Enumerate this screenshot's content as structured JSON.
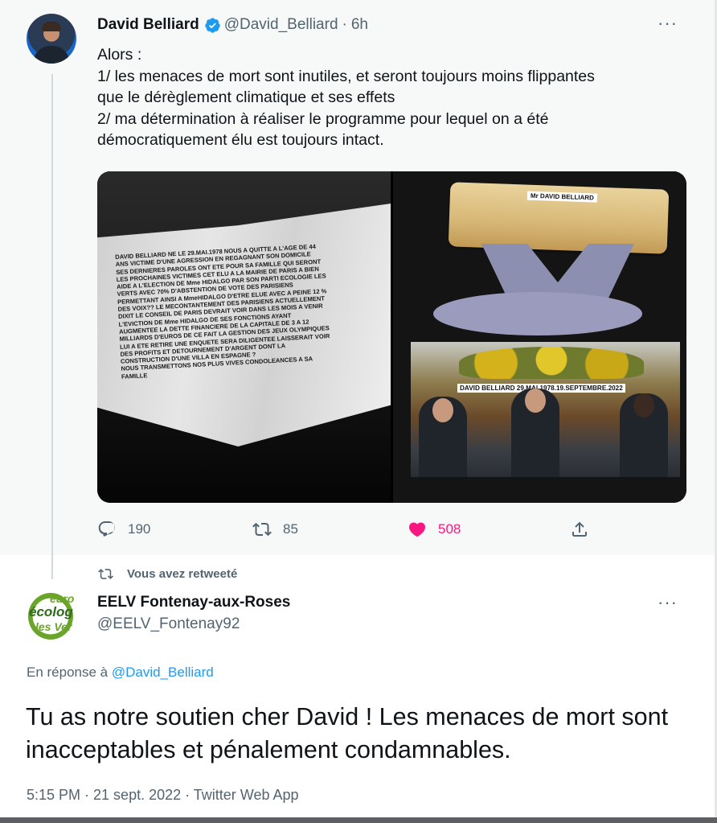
{
  "tweet": {
    "author_name": "David Belliard",
    "author_handle": "@David_Belliard",
    "time": "6h",
    "more": "···",
    "lines": [
      "Alors :",
      "1/ les menaces de mort sont inutiles, et seront toujours moins flippantes",
      "que le dérèglement climatique et ses effets",
      "2/ ma détermination à réaliser le programme pour lequel on a été",
      "démocratiquement élu est toujours intact."
    ],
    "media": {
      "letter_text": "DAVID BELLIARD NE LE 29.MAI.1978  NOUS A QUITTE A L'AGE DE 44\nANS  VICTIME D'UNE AGRESSION EN REGAGNANT SON DOMICILE\nSES DERNIERES PAROLES ONT ETE POUR SA FAMILLE QUI SERONT\nLES PROCHAINES VICTIMES CET ELU A LA MAIRIE DE PARIS A BIEN\nAIDE A L'ELECTION DE Mme HIDALGO PAR SON PARTI ECOLOGIE LES\nVERTS AVEC 70% D'ABSTENTION DE VOTE DES PARISIENS\nPERMETTANT AINSI A MmeHIDALGO D'ETRE ELUE AVEC A PEINE 12 %\nDES VOIX?? LE MECONTANTEMENT DES PARISIENS ACTUELLEMENT\nDIXIT LE CONSEIL DE PARIS DEVRAIT VOIR DANS LES MOIS A VENIR\nL'EVICTION DE Mme  HIDALGO DE SES FONCTIONS AYANT\nAUGMENTEE LA DETTE FINANCIERE DE LA CAPITALE DE 3 A 12\nMILLIARDS D'EUROS  DE CE FAIT LA GESTION DES JEUX OLYMPIQUES\nLUI A ETE RETIRE UNE ENQUETE SERA DILIGENTEE LAISSERAIT VOIR\nDES PROFITS ET DETOURNEMENT D'ARGENT DONT LA\nCONSTRUCTION D'UNE VILLA EN ESPAGNE ?\nNOUS TRANSMETTONS NOS PLUS VIVES CONDOLEANCES A SA\nFAMILLE",
      "coffin_label": "Mr DAVID BELLIARD",
      "photo_label": "DAVID BELLIARD 29.MAI.1978.19.SEPTEMBRE.2022"
    },
    "actions": {
      "replies": "190",
      "retweets": "85",
      "likes": "508"
    }
  },
  "retweet_banner": "Vous avez retweeté",
  "reply": {
    "avatar_text": [
      "euro",
      "écolog",
      "les Ver"
    ],
    "author_name": "EELV Fontenay-aux-Roses",
    "author_handle": "@EELV_Fontenay92",
    "more": "···",
    "in_reply_prefix": "En réponse à",
    "in_reply_handle": "@David_Belliard",
    "text": "Tu as notre soutien cher David ! Les menaces de mort sont inacceptables et pénalement condamnables.",
    "meta": "5:15 PM · 21 sept. 2022 · Twitter Web App"
  },
  "colors": {
    "accent": "#1d9bf0",
    "like": "#f91880",
    "muted": "#536471"
  }
}
